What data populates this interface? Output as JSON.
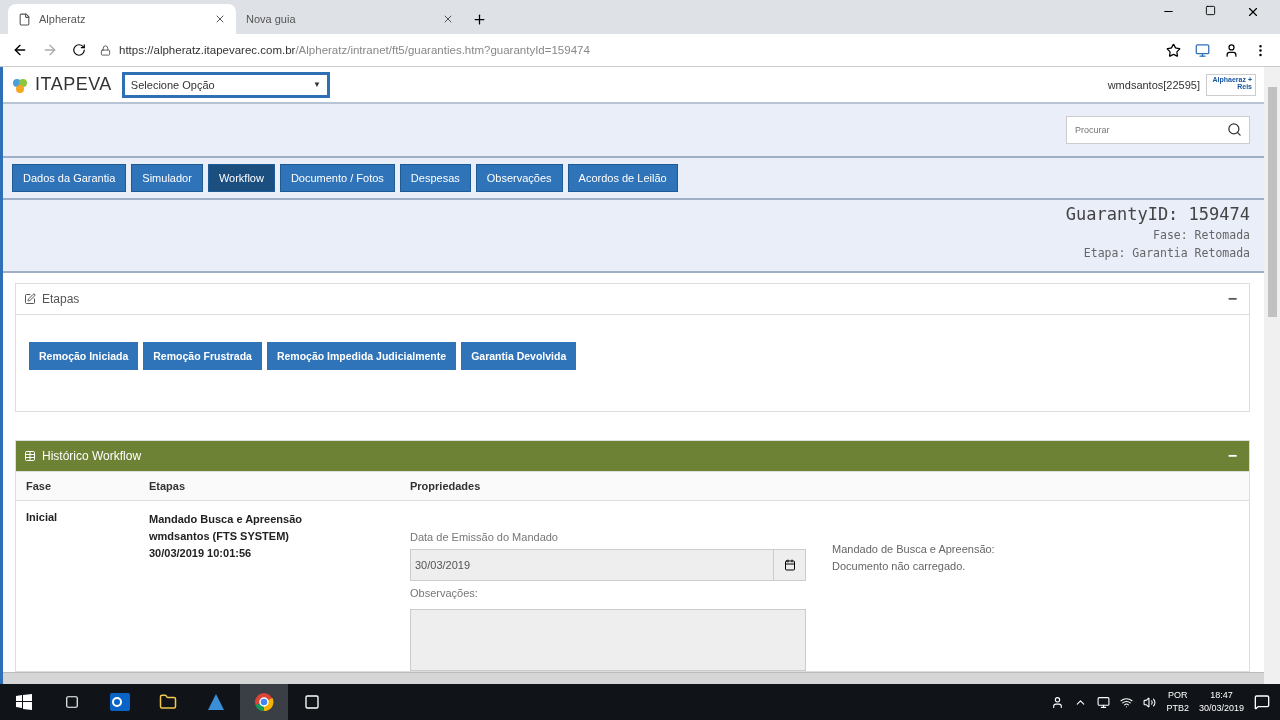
{
  "browser": {
    "tabs": [
      {
        "title": "Alpheratz",
        "selected": true
      },
      {
        "title": "Nova guia",
        "selected": false
      }
    ],
    "url_host": "https://alpheratz.itapevarec.com.br",
    "url_path": "/Alpheratz/intranet/ft5/guaranties.htm?guarantyId=159474"
  },
  "header": {
    "brand": "ITAPEVA",
    "select": "Selecione Opção",
    "select_caret": "▼",
    "user": "wmdsantos[22595]",
    "partner_logo_top": "Alphaeraz +",
    "partner_logo_bottom": "Reis"
  },
  "search": {
    "placeholder": "Procurar"
  },
  "nav_tabs": [
    {
      "label": "Dados da Garantia",
      "selected": false
    },
    {
      "label": "Simulador",
      "selected": false
    },
    {
      "label": "Workflow",
      "selected": true
    },
    {
      "label": "Documento / Fotos",
      "selected": false
    },
    {
      "label": "Despesas",
      "selected": false
    },
    {
      "label": "Observações",
      "selected": false
    },
    {
      "label": "Acordos de Leilão",
      "selected": false
    }
  ],
  "guaranty": {
    "id": "GuarantyID: 159474",
    "fase": "Fase: Retomada",
    "etapa": "Etapa: Garantia Retomada"
  },
  "etapas_panel": {
    "title": "Etapas",
    "collapse": "−",
    "buttons": [
      "Remoção Iniciada",
      "Remoção Frustrada",
      "Remoção Impedida Judicialmente",
      "Garantia Devolvida"
    ]
  },
  "history_panel": {
    "title": "Histórico Workflow",
    "collapse": "−",
    "columns": [
      "Fase",
      "Etapas",
      "Propriedades"
    ],
    "rows": [
      {
        "fase": "Inicial",
        "etapa_lines": [
          "Mandado Busca e Apreensão",
          "wmdsantos (FTS SYSTEM)",
          "30/03/2019 10:01:56"
        ],
        "date_label": "Data de Emissão do Mandado",
        "date_value": "30/03/2019",
        "obs_label": "Observações:",
        "doc_lines": [
          "Mandado de Busca e Apreensão:",
          "Documento não carregado."
        ]
      }
    ]
  },
  "taskbar": {
    "lang_top": "POR",
    "lang_bottom": "PTB2",
    "time": "18:47",
    "date": "30/03/2019"
  }
}
